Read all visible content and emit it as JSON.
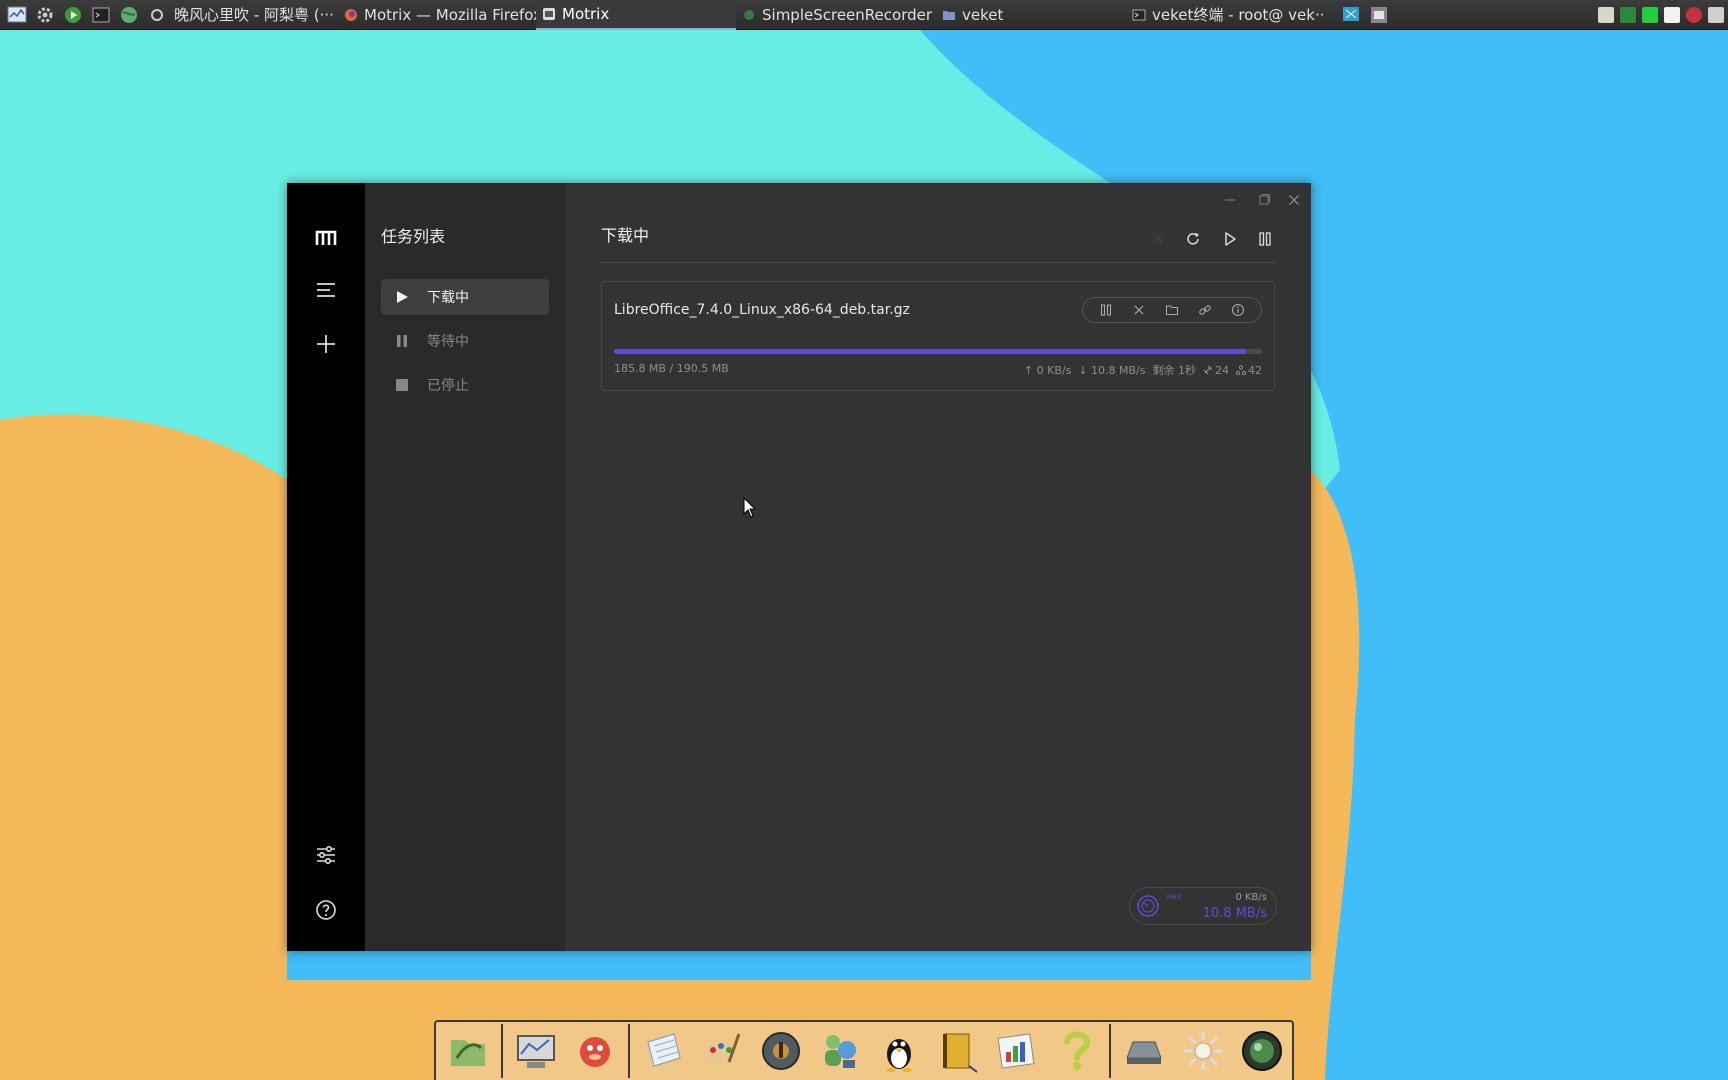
{
  "taskbar": {
    "tasks": [
      {
        "label": "晚风心里吹 - 阿梨粤 (···"
      },
      {
        "label": "Motrix — Mozilla Firefox"
      },
      {
        "label": "Motrix"
      },
      {
        "label": "SimpleScreenRecorder"
      },
      {
        "label": "veket"
      },
      {
        "label": "veket终端 - root@ vek···"
      }
    ]
  },
  "window": {
    "subnav_title": "任务列表",
    "subnav_items": [
      {
        "label": "下载中"
      },
      {
        "label": "等待中"
      },
      {
        "label": "已停止"
      }
    ],
    "main_title": "下载中"
  },
  "task": {
    "filename": "LibreOffice_7.4.0_Linux_x86-64_deb.tar.gz",
    "progress_fraction": 0.975,
    "size": "185.8 MB / 190.5 MB",
    "upload_speed": "↑ 0 KB/s",
    "download_speed": "↓ 10.8 MB/s",
    "remaining": "剩余 1秒",
    "connections": "24",
    "seeders": "42"
  },
  "speedometer": {
    "label": "MAX",
    "upload": "0 KB/s",
    "download": "10.8 MB/s"
  },
  "colors": {
    "accent": "#5b4fd6",
    "window_bg": "#333333",
    "sidebar_bg": "#000000",
    "subnav_bg": "#2a2a2a"
  }
}
